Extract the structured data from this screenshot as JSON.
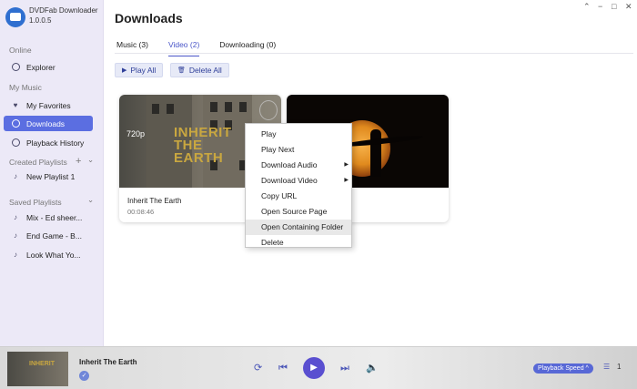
{
  "app": {
    "name": "DVDFab Downloader",
    "version": "1.0.0.5"
  },
  "window": {
    "minimize": "−",
    "maximize": "□",
    "close": "✕",
    "extra": "⌃"
  },
  "sidebar": {
    "online_label": "Online",
    "explorer": "Explorer",
    "mymusic_label": "My Music",
    "favorites": "My Favorites",
    "downloads": "Downloads",
    "history": "Playback History",
    "created_label": "Created Playlists",
    "created_add": "+",
    "created_toggle": "⌄",
    "created_items": [
      "New Playlist 1"
    ],
    "saved_label": "Saved Playlists",
    "saved_toggle": "⌄",
    "saved_items": [
      "Mix - Ed sheer...",
      "End Game - B...",
      "Look What Yo..."
    ]
  },
  "main": {
    "title": "Downloads",
    "tabs": [
      "Music (3)",
      "Video (2)",
      "Downloading (0)"
    ],
    "active_tab": "Video (2)",
    "play_all": "Play All",
    "delete_all": "Delete All"
  },
  "cards": [
    {
      "name": "Inherit The Earth",
      "duration": "00:08:46",
      "quality": "720p",
      "thumb_text_1": "INHERIT",
      "thumb_text_2": "THE",
      "thumb_text_3": "EARTH"
    },
    {
      "name": "",
      "duration": ""
    }
  ],
  "context_menu": {
    "items": [
      "Play",
      "Play Next",
      "Download Audio",
      "Download Video",
      "Copy URL",
      "Open Source Page",
      "Open Containing Folder",
      "Delete"
    ],
    "highlighted": "Open Containing Folder"
  },
  "player": {
    "title": "Inherit The Earth",
    "speed_label": "Playback Speed ^",
    "queue_count": "1",
    "icons": {
      "repeat": "repeat-icon",
      "prev": "previous-icon",
      "play": "play-icon",
      "next": "next-icon",
      "volume": "volume-icon"
    }
  },
  "colors": {
    "accent": "#5b6ee1",
    "sidebar_bg": "#ece9f7",
    "play_button": "#5a4fd0"
  }
}
